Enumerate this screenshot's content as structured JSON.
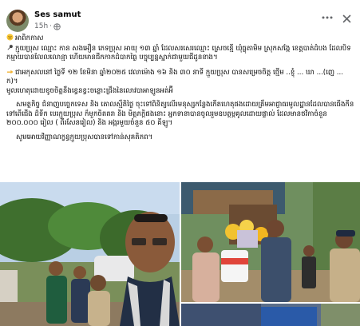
{
  "post": {
    "author": "Ses samut",
    "time": "15h",
    "dot": "·",
    "text": {
      "title": "អាពិកកាស",
      "p1": "ក្មួយប្រុស ឈ្មោះ កាន សងអឿន ភេទប្រុស អាយុ ១៣ ឆ្នាំ ដែលសរសេរឈ្មោះ ស្រេចន្មើ ឃុំធ្លុតាមិម ស្រុកសង្កែ ខេត្តបាត់ដំបង ដែលបិទកម្មាយបានលែលលោន្មា ហើយមានជីកកាកដំបាកធ្ងៃ បច្ចុប្បន្នស្នាក់ជាមួយជីដូនខាង។",
      "p2": "ជាអកុសលនៅ ថ្ងៃទី ១២ ខែមិនា ឆ្នាំ២០២៥ វេលាម៉ោង ១៦ និង ៣០ នាទី ក្មួយប្រុស បានសម្រេចចិត្ត ថ្មើម ..ខ្ញុំ ... ឃា ...(ញេ ... ក)។",
      "p3": "មូលហេតុដោយខូចចិត្តនឹងខ្វេនខ្វះចន្លោះជ្រឹងនៃលោវបាអាឡូនអត់អ៊ី",
      "p4": "សមត្ថកិច្ច ជំនាញបច្ចេកទេស និង គោលស្មឹតិថ្ងៃ ចុះទៅពិនិត្យលើរមនុស្សកន្លែងកើតហេតុផងដោយគ្រឹមអាជ្ញាធរមូលដ្ឋានដែលបានធើងកីនទៅពើជើង ដ៏ទីក បេរក្មួយប្រុស ក៏មួកចិតតរា និង មិត្តភក្តិផងនោះ អ្នកទានាបានចូលរួមឧបត្ថម្ភគូលដោយផ្ទាល់ ដែលមានថវិកាចំនួន ២០០.០០០ រៀល ( ពីរសែនរៀល) និង អង្ករមួយចំនួន ៥០ គីឡូ។",
      "p5": "សូមអោយវិញ្ញាណក្ខន្ធក្មួយប្រុសបានទៅកាន់សុគតិភព។"
    },
    "photos": {
      "caption_1": "",
      "caption_2": ""
    }
  },
  "colors": {
    "meta": "#65676b",
    "text": "#050505",
    "sky": "#b9cfe4"
  },
  "icons": {
    "more": "more-horizontal-icon",
    "close": "close-icon",
    "globe": "globe-icon",
    "emoji": "emoji-icon"
  }
}
